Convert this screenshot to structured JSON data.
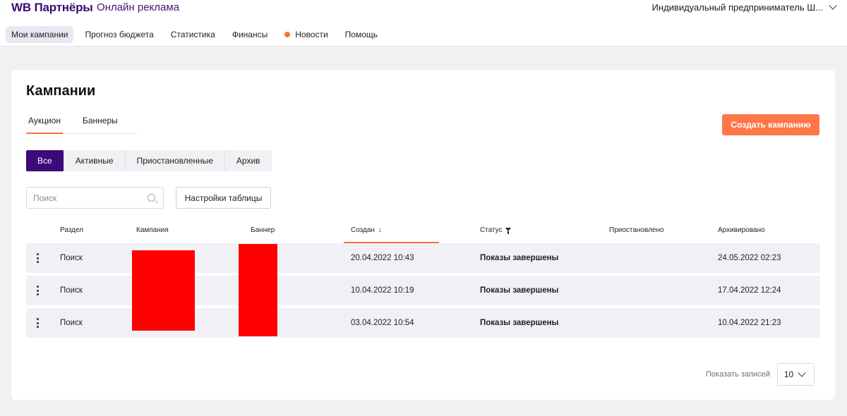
{
  "header": {
    "brand": "WB Партнёры",
    "product": "Онлайн реклама",
    "account": "Индивидуальный предприниматель Ш..."
  },
  "nav": {
    "items": [
      {
        "label": "Мои кампании"
      },
      {
        "label": "Прогноз бюджета"
      },
      {
        "label": "Статистика"
      },
      {
        "label": "Финансы"
      },
      {
        "label": "Новости"
      },
      {
        "label": "Помощь"
      }
    ]
  },
  "page": {
    "title": "Кампании",
    "tabs": [
      {
        "label": "Аукцион"
      },
      {
        "label": "Баннеры"
      }
    ],
    "create_button": "Создать кампанию",
    "filters": [
      {
        "label": "Все"
      },
      {
        "label": "Активные"
      },
      {
        "label": "Приостановленные"
      },
      {
        "label": "Архив"
      }
    ],
    "search_placeholder": "Поиск",
    "settings_button": "Настройки таблицы"
  },
  "table": {
    "columns": [
      "Раздел",
      "Кампания",
      "Баннер",
      "Создан",
      "Статус",
      "Приостановлено",
      "Архивировано"
    ],
    "rows": [
      {
        "section": "Поиск",
        "created": "20.04.2022 10:43",
        "status": "Показы завершены",
        "paused": "",
        "archived": "24.05.2022 02:23"
      },
      {
        "section": "Поиск",
        "created": "10.04.2022 10:19",
        "status": "Показы завершены",
        "paused": "",
        "archived": "17.04.2022 12:24"
      },
      {
        "section": "Поиск",
        "created": "03.04.2022 10:54",
        "status": "Показы завершены",
        "paused": "",
        "archived": "10.04.2022 21:23"
      }
    ]
  },
  "pagination": {
    "label": "Показать записей",
    "value": "10"
  },
  "colors": {
    "brand": "#3b0c73",
    "accent": "#ff7748",
    "redaction": "#ff0000"
  }
}
